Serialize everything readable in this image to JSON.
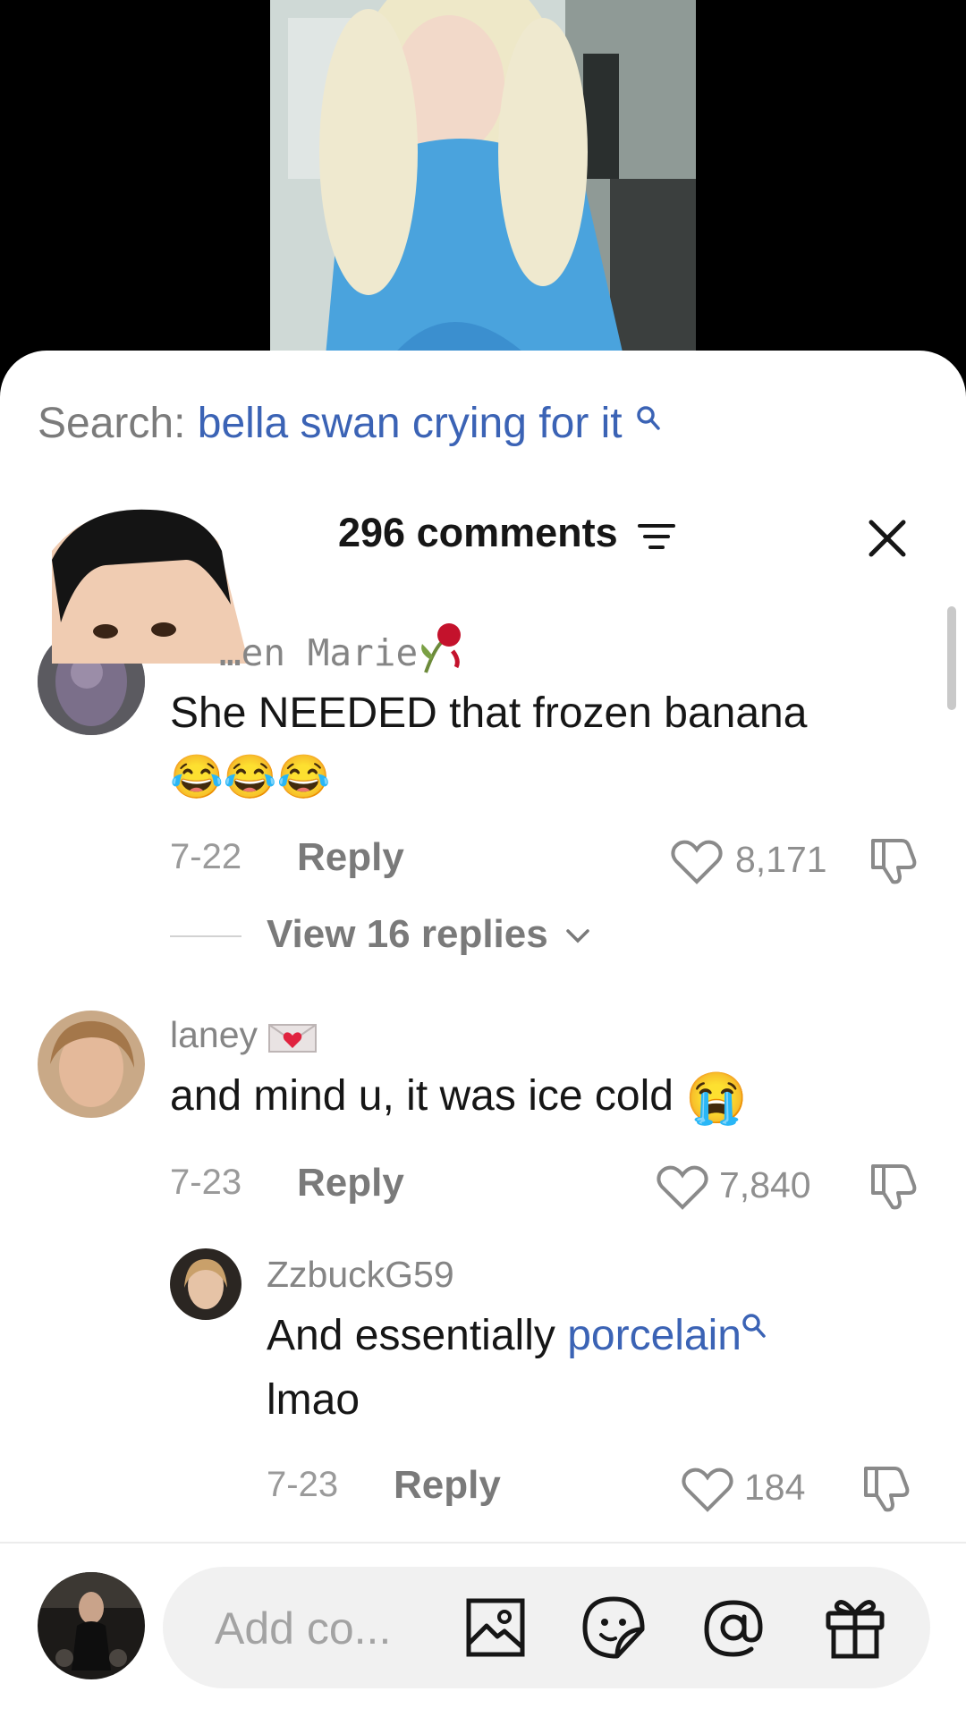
{
  "search": {
    "prefix": "Search:",
    "term": "bella swan crying for it"
  },
  "header": {
    "count": "296 comments"
  },
  "comments": [
    {
      "username": "…en Marie",
      "text": "She NEEDED that frozen banana",
      "emoji_line": "😂😂😂",
      "date": "7-22",
      "reply_label": "Reply",
      "likes": "8,171",
      "view_replies": "View 16 replies"
    },
    {
      "username": "laney",
      "text": "and mind u, it was ice cold",
      "emoji": "😭",
      "date": "7-23",
      "reply_label": "Reply",
      "likes": "7,840"
    },
    {
      "username": "ZzbuckG59",
      "text_before": "And essentially ",
      "link": "porcelain",
      "text_after": "lmao",
      "date": "7-23",
      "reply_label": "Reply",
      "likes": "184"
    }
  ],
  "composer": {
    "placeholder": "Add co..."
  },
  "colors": {
    "link": "#3b63b5",
    "muted": "#858585",
    "text": "#161616"
  }
}
